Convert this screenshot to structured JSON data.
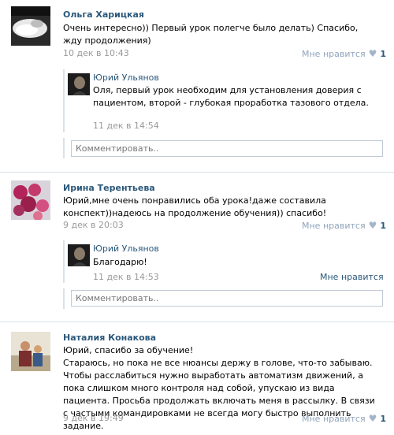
{
  "comments": [
    {
      "author": "Ольга Харицкая",
      "text": "Очень интересно)) Первый урок полегче было делать) Спасибо, жду продолжения)",
      "date": "10 дек в 10:43",
      "like_label": "Мне нравится",
      "like_count": "1",
      "reply": {
        "author": "Юрий Ульянов",
        "text": "Оля, первый урок необходим для установления доверия с пациентом, второй - глубокая проработка тазового отдела.",
        "date": "11 дек в 14:54"
      },
      "comment_placeholder": "Комментировать.."
    },
    {
      "author": "Ирина Терентьева",
      "text": "Юрий,мне очень понравились оба урока!даже составила конспект))надеюсь на продолжение обучения)) спасибо!",
      "date": "9 дек в 20:03",
      "like_label": "Мне нравится",
      "like_count": "1",
      "reply": {
        "author": "Юрий Ульянов",
        "text": "Благодарю!",
        "date": "11 дек в 14:53",
        "like_label": "Мне нравится"
      },
      "comment_placeholder": "Комментировать.."
    },
    {
      "author": "Наталия Конакова",
      "text": "Юрий, спасибо за обучение!\nСтараюсь, но пока не все нюансы держу в голове, что-то забываю. Чтобы расслабиться нужно выработать автоматизм движений, а пока слишком много контроля над собой, упускаю из вида пациента. Просьба продолжать включать меня в рассылку. В связи с частыми командировками не всегда могу быстро выполнить задание.",
      "date": "9 дек в 19:49",
      "like_label": "Мне нравится",
      "like_count": "1"
    }
  ],
  "colors": {
    "link": "#2b587a",
    "date": "#999999",
    "like": "#90a4bc",
    "divider": "#dae1e8",
    "input_border": "#c0cad5"
  }
}
